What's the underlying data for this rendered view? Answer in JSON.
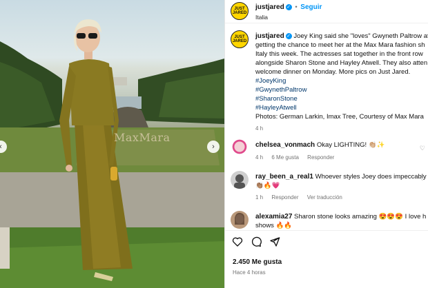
{
  "post": {
    "username": "justjared",
    "follow_label": "Seguir",
    "location": "Italia",
    "avatar_text": "JUST JARED",
    "caption": {
      "lines": [
        "Joey King said she \"loves\" Gwyneth Paltrow aft",
        "getting the chance to meet her at the Max Mara fashion sh",
        "Italy this week. The actresses sat together in the front row",
        "alongside Sharon Stone and Hayley Atwell. They also atten",
        "welcome dinner on Monday. More pics on Just Jared."
      ],
      "hashtags": [
        "#JoeyKing",
        "#GwynethPaltrow",
        "#SharonStone",
        "#HayleyAtwell"
      ],
      "credits": "Photos: German Larkin, Imax Tree, Courtesy of Max Mara",
      "time": "4 h"
    },
    "photo_sign_text": "MaxMara"
  },
  "comments": [
    {
      "user": "chelsea_vonmach",
      "text": "Okay LIGHTING! 👏🏼✨",
      "time": "4 h",
      "likes": "6 Me gusta",
      "reply": "Responder",
      "translate": ""
    },
    {
      "user": "ray_been_a_real1",
      "text": "Whoever styles Joey does impeccably we",
      "text2": "👏🏽🔥💗",
      "time": "1 h",
      "likes": "",
      "reply": "Responder",
      "translate": "Ver traducción"
    },
    {
      "user": "alexamia27",
      "text": "Sharon stone looks amazing 😍😍😍 I love h",
      "text2": "shows 🔥🔥",
      "time": "",
      "likes": "",
      "reply": "",
      "translate": ""
    }
  ],
  "footer": {
    "likes": "2.450 Me gusta",
    "time": "Hace 4 horas"
  },
  "icons": [
    "heart-icon",
    "comment-icon",
    "share-icon",
    "more-options-icon",
    "verified-badge-icon",
    "chevron-left-icon",
    "chevron-right-icon"
  ],
  "colors": {
    "link": "#0095f6",
    "hashtag": "#00376b",
    "logo": "#ffd600",
    "dress": "#8a7a22"
  }
}
